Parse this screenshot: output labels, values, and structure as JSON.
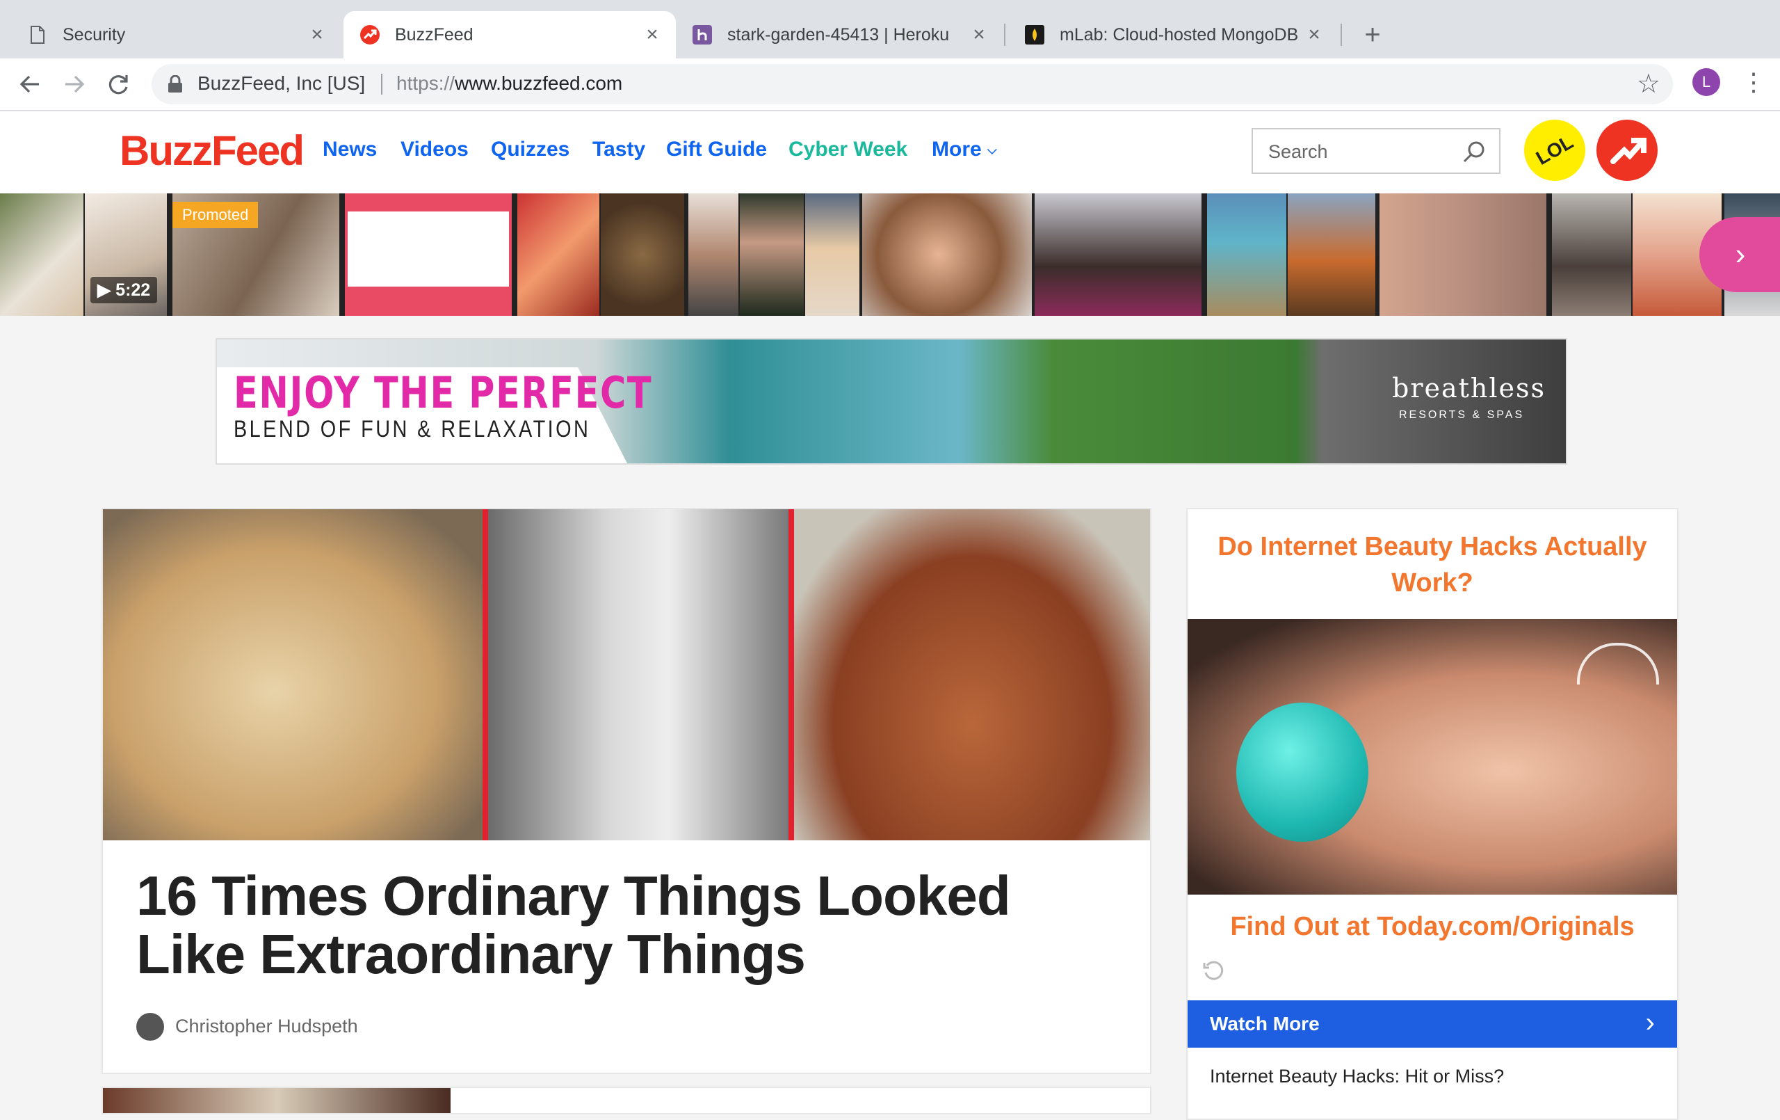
{
  "browser": {
    "tabs": [
      {
        "title": "Security",
        "icon": "document-icon"
      },
      {
        "title": "BuzzFeed",
        "icon": "buzzfeed-trending-icon",
        "active": true
      },
      {
        "title": "stark-garden-45413 | Heroku",
        "icon": "heroku-icon"
      },
      {
        "title": "mLab: Cloud-hosted MongoDB",
        "icon": "mlab-icon"
      }
    ],
    "new_tab": "+",
    "org": "BuzzFeed, Inc [US]",
    "url_scheme": "https://",
    "url_host": "www.buzzfeed.com",
    "profile_initial": "L",
    "accent": "#8e44ad"
  },
  "site": {
    "logo": "BuzzFeed",
    "nav": [
      {
        "label": "News",
        "color": "#0f65ef"
      },
      {
        "label": "Videos",
        "color": "#0f65ef"
      },
      {
        "label": "Quizzes",
        "color": "#0f65ef"
      },
      {
        "label": "Tasty",
        "color": "#0f65ef"
      },
      {
        "label": "Gift Guide",
        "color": "#0f65ef"
      },
      {
        "label": "Cyber Week",
        "color": "#1bb99c"
      },
      {
        "label": "More",
        "color": "#0f65ef"
      }
    ],
    "search_placeholder": "Search",
    "lol_badge": "LOL",
    "brand_color": "#ee3322"
  },
  "strip": {
    "promoted": "Promoted",
    "video_duration": "5:22"
  },
  "banner": {
    "headline": "ENJOY THE PERFECT",
    "subline": "BLEND OF FUN & RELAXATION",
    "brand": "breathless",
    "brand_sub": "RESORTS & SPAS"
  },
  "article": {
    "headline": "16 Times Ordinary Things Looked Like Extraordinary Things",
    "author": "Christopher Hudspeth"
  },
  "sidebar_ad": {
    "question": "Do Internet Beauty Hacks Actually Work?",
    "cta": "Find Out at Today.com/Originals",
    "button": "Watch More",
    "caption": "Internet Beauty Hacks: Hit or Miss?"
  }
}
